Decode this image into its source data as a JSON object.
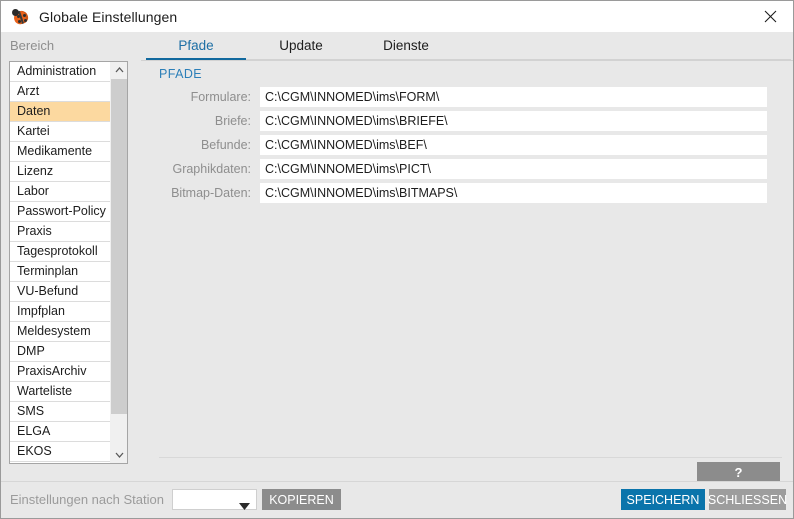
{
  "window": {
    "title": "Globale Einstellungen",
    "icon": "ladybug-icon",
    "close_label": "✕"
  },
  "sidebar": {
    "header": "Bereich",
    "selected": "Daten",
    "items": [
      {
        "label": "Administration"
      },
      {
        "label": "Arzt"
      },
      {
        "label": "Daten"
      },
      {
        "label": "Kartei"
      },
      {
        "label": "Medikamente"
      },
      {
        "label": "Lizenz"
      },
      {
        "label": "Labor"
      },
      {
        "label": "Passwort-Policy"
      },
      {
        "label": "Praxis"
      },
      {
        "label": "Tagesprotokoll"
      },
      {
        "label": "Terminplan"
      },
      {
        "label": "VU-Befund"
      },
      {
        "label": "Impfplan"
      },
      {
        "label": "Meldesystem"
      },
      {
        "label": "DMP"
      },
      {
        "label": "PraxisArchiv"
      },
      {
        "label": "Warteliste"
      },
      {
        "label": "SMS"
      },
      {
        "label": "ELGA"
      },
      {
        "label": "EKOS"
      }
    ]
  },
  "tabs": [
    {
      "label": "Pfade",
      "active": true
    },
    {
      "label": "Update",
      "active": false
    },
    {
      "label": "Dienste",
      "active": false
    }
  ],
  "main": {
    "section_title": "PFADE",
    "fields": [
      {
        "label": "Formulare:",
        "value": "C:\\CGM\\INNOMED\\ims\\FORM\\"
      },
      {
        "label": "Briefe:",
        "value": "C:\\CGM\\INNOMED\\ims\\BRIEFE\\"
      },
      {
        "label": "Befunde:",
        "value": "C:\\CGM\\INNOMED\\ims\\BEF\\"
      },
      {
        "label": "Graphikdaten:",
        "value": "C:\\CGM\\INNOMED\\ims\\PICT\\"
      },
      {
        "label": "Bitmap-Daten:",
        "value": "C:\\CGM\\INNOMED\\ims\\BITMAPS\\"
      }
    ]
  },
  "help": {
    "label": "?"
  },
  "footer": {
    "station_label": "Einstellungen nach Station",
    "station_value": "",
    "copy_label": "KOPIEREN",
    "save_label": "SPEICHERN",
    "close_label": "SCHLIESSEN"
  },
  "colors": {
    "accent": "#0a74ab",
    "tab_active": "#11699e",
    "section_title": "#2c7fb8",
    "selection": "#fcd9a0",
    "window_bg": "#e8e8e8",
    "button_grey": "#8c8c8c"
  }
}
